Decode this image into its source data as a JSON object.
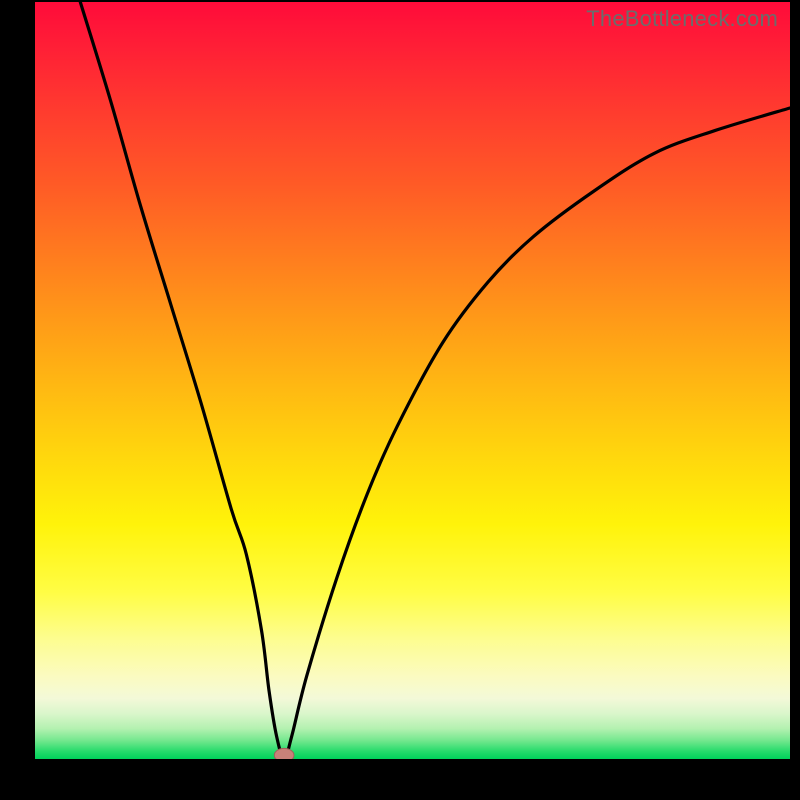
{
  "watermark": "TheBottleneck.com",
  "colors": {
    "curve": "#000000",
    "marker_fill": "#c98179",
    "marker_stroke": "#a06059",
    "background_top": "#ff0b3a",
    "background_bottom": "#00d25b",
    "page_bg": "#000000"
  },
  "chart_data": {
    "type": "line",
    "title": "",
    "xlabel": "",
    "ylabel": "",
    "xlim": [
      0,
      100
    ],
    "ylim": [
      0,
      100
    ],
    "grid": false,
    "legend": false,
    "note": "Bottleneck-style curve; y≈0 at optimal x, rising toward 100 away from it. Values estimated from pixels.",
    "series": [
      {
        "name": "bottleneck_curve",
        "x": [
          6,
          10,
          14,
          18,
          22,
          26,
          28,
          30,
          31,
          32,
          33,
          34,
          36,
          40,
          44,
          48,
          54,
          60,
          66,
          74,
          82,
          90,
          100
        ],
        "values": [
          100,
          87,
          73,
          60,
          47,
          33,
          27,
          17,
          9,
          3,
          0,
          3,
          11,
          24,
          35,
          44,
          55,
          63,
          69,
          75,
          80,
          83,
          86
        ]
      }
    ],
    "marker": {
      "x": 33,
      "y": 0.5,
      "rx": 1.3,
      "ry": 0.9
    }
  }
}
